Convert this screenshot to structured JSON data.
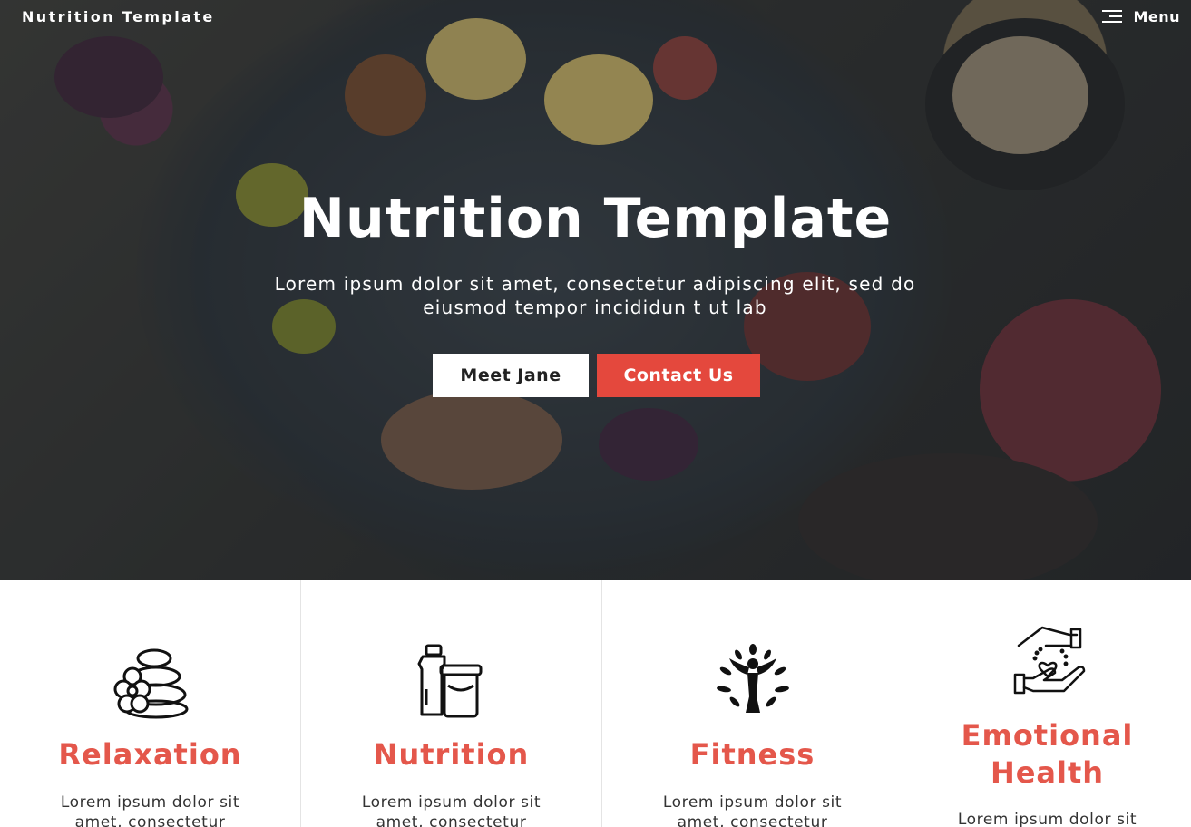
{
  "header": {
    "brand": "Nutrition Template",
    "menu_label": "Menu"
  },
  "hero": {
    "title": "Nutrition Template",
    "subtitle": "Lorem ipsum dolor sit amet, consectetur adipiscing elit, sed do eiusmod tempor incididun t ut lab",
    "buttons": [
      {
        "label": "Meet Jane"
      },
      {
        "label": "Contact Us"
      }
    ]
  },
  "features": [
    {
      "icon": "spa-stones-icon",
      "title": "Relaxation",
      "text": "Lorem ipsum dolor sit amet, consectetur"
    },
    {
      "icon": "food-jars-icon",
      "title": "Nutrition",
      "text": "Lorem ipsum dolor sit amet, consectetur"
    },
    {
      "icon": "person-tree-icon",
      "title": "Fitness",
      "text": "Lorem ipsum dolor sit amet, consectetur"
    },
    {
      "icon": "hands-heart-icon",
      "title": "Emotional Health",
      "text": "Lorem ipsum dolor sit"
    }
  ],
  "colors": {
    "accent": "#e4483d",
    "feature_title": "#e4574b"
  }
}
